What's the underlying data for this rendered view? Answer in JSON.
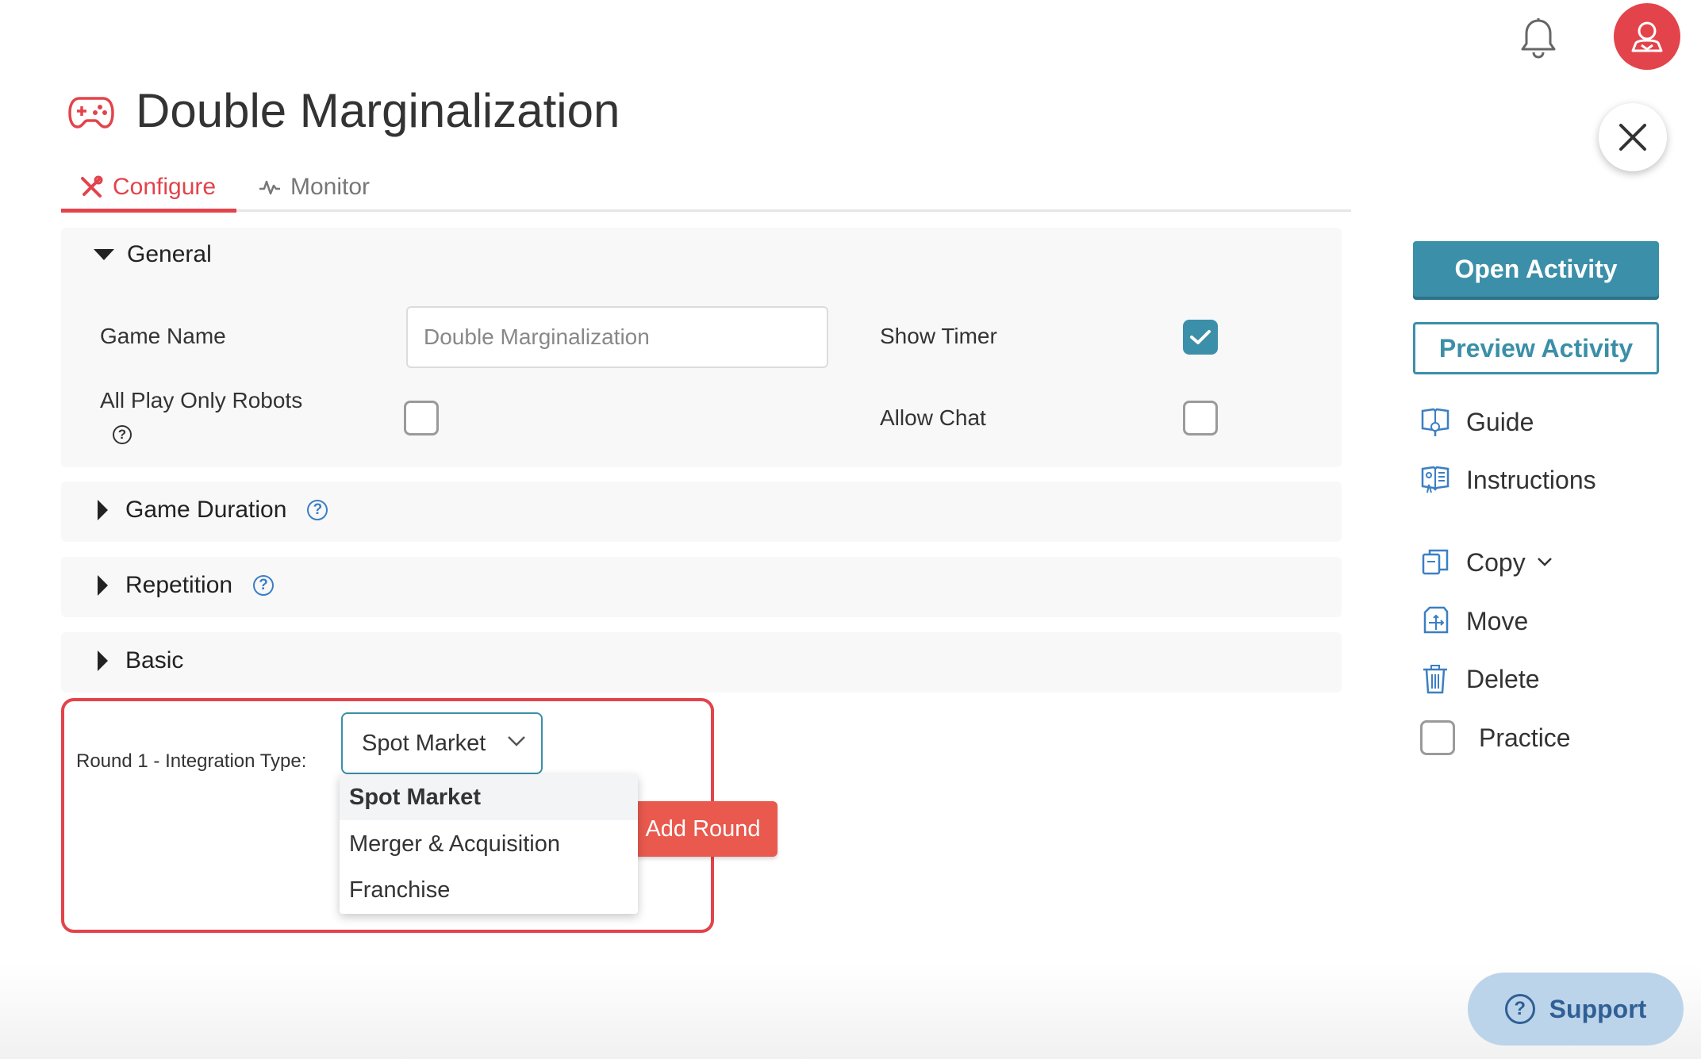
{
  "header": {
    "title": "Double Marginalization"
  },
  "tabs": [
    {
      "label": "Configure",
      "active": true
    },
    {
      "label": "Monitor",
      "active": false
    }
  ],
  "general": {
    "heading": "General",
    "game_name_label": "Game Name",
    "game_name_value": "Double Marginalization",
    "show_timer_label": "Show Timer",
    "show_timer_checked": true,
    "all_play_robots_label": "All Play Only Robots",
    "all_play_robots_checked": false,
    "allow_chat_label": "Allow Chat",
    "allow_chat_checked": false,
    "help_glyph": "?"
  },
  "sections": [
    {
      "label": "Game Duration",
      "has_help": true
    },
    {
      "label": "Repetition",
      "has_help": true
    },
    {
      "label": "Basic",
      "has_help": false
    }
  ],
  "round": {
    "label": "Round 1 - Integration Type:",
    "selected": "Spot Market",
    "options": [
      "Spot Market",
      "Merger & Acquisition",
      "Franchise"
    ],
    "add_round_label": "Add Round"
  },
  "sidebar": {
    "open_activity": "Open Activity",
    "preview_activity": "Preview Activity",
    "items": [
      {
        "label": "Guide",
        "icon": "guide-icon"
      },
      {
        "label": "Instructions",
        "icon": "instructions-icon"
      },
      {
        "label": "Copy",
        "icon": "copy-icon"
      },
      {
        "label": "Move",
        "icon": "move-icon"
      },
      {
        "label": "Delete",
        "icon": "trash-icon"
      },
      {
        "label": "Practice",
        "icon": "checkbox"
      }
    ]
  },
  "support": {
    "label": "Support",
    "glyph": "?"
  },
  "colors": {
    "brand_red": "#e3434b",
    "teal": "#3b8fa8",
    "help_blue": "#3b7fc4"
  }
}
